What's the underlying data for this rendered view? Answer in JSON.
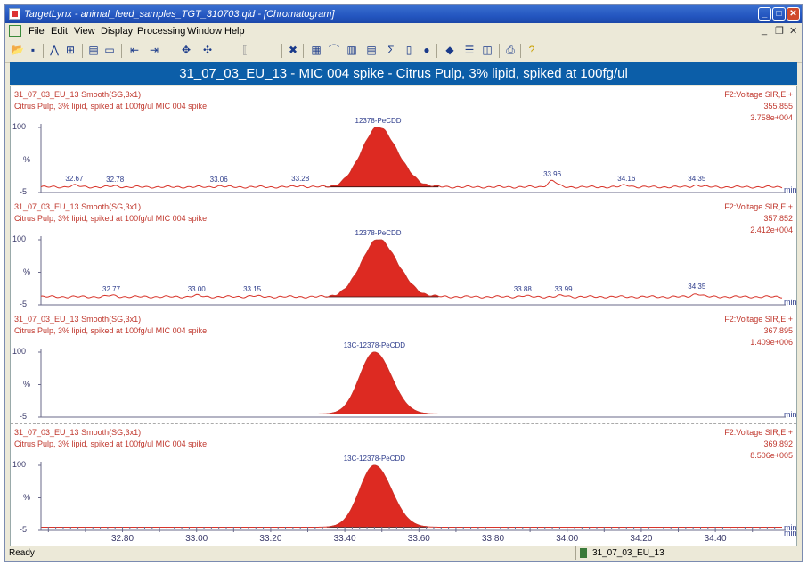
{
  "window": {
    "title": "TargetLynx - animal_feed_samples_TGT_310703.qld - [Chromatogram]",
    "controls": {
      "minimize": "_",
      "maximize": "□",
      "close": "✕"
    }
  },
  "menubar": {
    "items": [
      "File",
      "Edit",
      "View",
      "Display",
      "Processing",
      "Window",
      "Help"
    ],
    "mdi_controls": {
      "minimize": "_",
      "restore": "❐",
      "close": "✕"
    }
  },
  "toolbar": {
    "tools": [
      "open-icon",
      "save-icon",
      "peak-icon",
      "integrate-icon",
      "copy-icon",
      "monitor-icon",
      "shift-left-icon",
      "shift-right-icon",
      "zoom-in-icon",
      "zoom-out-icon",
      "bracket-icon",
      "cross-icon",
      "spectrum-icon",
      "chromatogram-icon",
      "bar-icon",
      "table-icon",
      "sum-icon",
      "book-icon",
      "globe-icon",
      "layers-icon",
      "split-h-icon",
      "split-v-icon",
      "print-icon",
      "help-icon"
    ]
  },
  "header": {
    "title": "31_07_03_EU_13 - MIC 004 spike - Citrus Pulp, 3% lipid,  spiked at 100fg/ul"
  },
  "colors": {
    "trace": "#d8342a",
    "peak_fill": "#dd2a22",
    "header_bg": "#0c5ea8",
    "label_red": "#c0382e",
    "label_blue": "#2b3a8a"
  },
  "chart_data": [
    {
      "type": "line",
      "sample": "31_07_03_EU_13  Smooth(SG,3x1)",
      "description": "Citrus Pulp, 3% lipid,  spiked at 100fg/ul MIC 004 spike",
      "function": "F2:Voltage SIR,EI+",
      "mass": "355.855",
      "intensity": "3.758e+004",
      "peak_label": "12378-PeCDD",
      "peak_rt": 33.49,
      "peak_width": 0.045,
      "peak_height": 100,
      "baseline": 4,
      "minor_peaks": [
        {
          "rt": 32.67,
          "label": "32.67",
          "height": 2.5
        },
        {
          "rt": 32.78,
          "label": "32.78",
          "height": 1.5
        },
        {
          "rt": 33.06,
          "label": "33.06",
          "height": 1.5
        },
        {
          "rt": 33.28,
          "label": "33.28",
          "height": 2
        },
        {
          "rt": 33.96,
          "label": "33.96",
          "height": 10
        },
        {
          "rt": 34.16,
          "label": "34.16",
          "height": 3
        },
        {
          "rt": 34.35,
          "label": "34.35",
          "height": 3
        }
      ],
      "y_ticks": [
        "100",
        "%",
        "-5"
      ],
      "xlabel": "min"
    },
    {
      "type": "line",
      "sample": "31_07_03_EU_13  Smooth(SG,3x1)",
      "description": "Citrus Pulp, 3% lipid,  spiked at 100fg/ul MIC 004 spike",
      "function": "F2:Voltage SIR,EI+",
      "mass": "357.852",
      "intensity": "2.412e+004",
      "peak_label": "12378-PeCDD",
      "peak_rt": 33.49,
      "peak_width": 0.045,
      "peak_height": 100,
      "baseline": 8,
      "minor_peaks": [
        {
          "rt": 32.77,
          "label": "32.77",
          "height": 2
        },
        {
          "rt": 33.0,
          "label": "33.00",
          "height": 2
        },
        {
          "rt": 33.15,
          "label": "33.15",
          "height": 1.5
        },
        {
          "rt": 33.88,
          "label": "33.88",
          "height": 1.5
        },
        {
          "rt": 33.99,
          "label": "33.99",
          "height": 2
        },
        {
          "rt": 34.35,
          "label": "34.35",
          "height": 5
        }
      ],
      "y_ticks": [
        "100",
        "%",
        "-5"
      ],
      "xlabel": "min"
    },
    {
      "type": "line",
      "sample": "31_07_03_EU_13  Smooth(SG,3x1)",
      "description": "Citrus Pulp, 3% lipid,  spiked at 100fg/ul MIC 004 spike",
      "function": "F2:Voltage SIR,EI+",
      "mass": "367.895",
      "intensity": "1.409e+006",
      "peak_label": "13C-12378-PeCDD",
      "peak_rt": 33.48,
      "peak_width": 0.04,
      "peak_height": 100,
      "baseline": 0,
      "minor_peaks": [],
      "y_ticks": [
        "100",
        "%",
        "-5"
      ],
      "xlabel": "min"
    },
    {
      "type": "line",
      "sample": "31_07_03_EU_13  Smooth(SG,3x1)",
      "description": "Citrus Pulp, 3% lipid,  spiked at 100fg/ul MIC 004 spike",
      "function": "F2:Voltage SIR,EI+",
      "mass": "369.892",
      "intensity": "8.506e+005",
      "peak_label": "13C-12378-PeCDD",
      "peak_rt": 33.48,
      "peak_width": 0.04,
      "peak_height": 100,
      "baseline": 0,
      "minor_peaks": [],
      "y_ticks": [
        "100",
        "%",
        "-5"
      ],
      "xlabel": "min"
    }
  ],
  "x_axis": {
    "range": [
      32.58,
      34.58
    ],
    "ticks": [
      "32.80",
      "33.00",
      "33.20",
      "33.40",
      "33.60",
      "33.80",
      "34.00",
      "34.20",
      "34.40"
    ],
    "tick_values": [
      32.8,
      33.0,
      33.2,
      33.4,
      33.6,
      33.8,
      34.0,
      34.2,
      34.4
    ],
    "unit": "min"
  },
  "statusbar": {
    "left": "Ready",
    "right": "31_07_03_EU_13"
  }
}
